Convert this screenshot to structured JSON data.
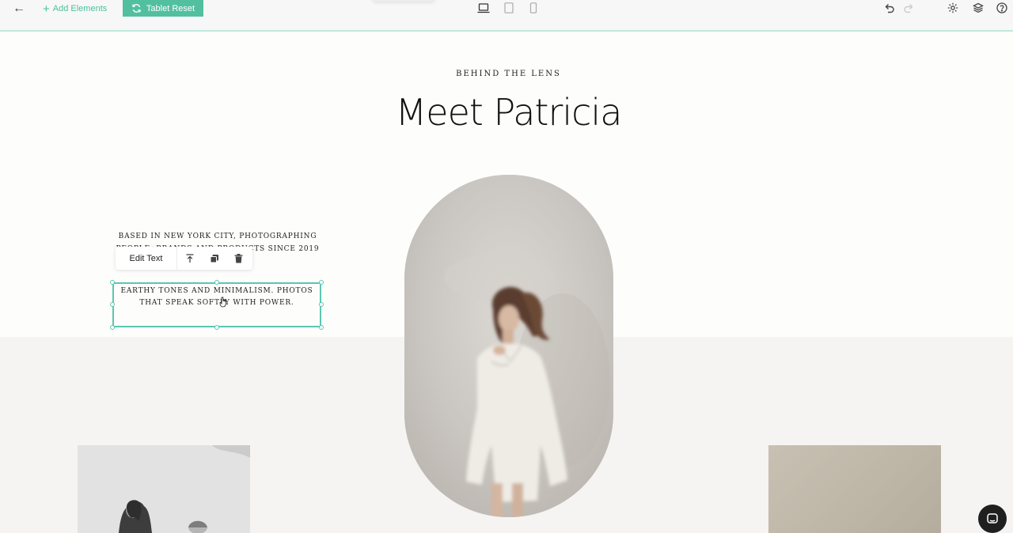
{
  "topbar": {
    "add_elements": "Add Elements",
    "reset_label": "Tablet Reset",
    "accent": "#52c09f"
  },
  "section": {
    "eyebrow": "BEHIND THE LENS",
    "title": "Meet Patricia",
    "bio_line1": "BASED IN NEW YORK CITY, PHOTOGRAPHING PEOPLE, BRANDS AND PRODUCTS SINCE 2019",
    "bio_line2": "EARTHY TONES AND MINIMALISM. PHOTOS THAT SPEAK SOFTLY WITH POWER."
  },
  "text_toolbar": {
    "edit_label": "Edit Text"
  },
  "icons": {
    "back": "arrow-left-icon",
    "desktop": "laptop-icon",
    "tablet": "tablet-icon",
    "mobile": "phone-icon",
    "undo": "undo-icon",
    "redo": "redo-icon",
    "settings": "gear-icon",
    "layers": "layers-icon",
    "help": "help-icon",
    "chat": "chat-icon"
  }
}
